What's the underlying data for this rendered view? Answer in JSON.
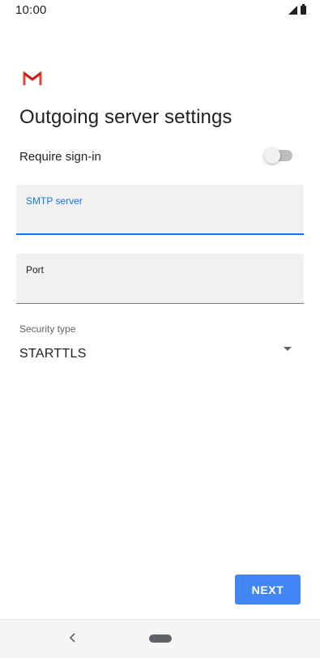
{
  "status_bar": {
    "time": "10:00",
    "icons": [
      "signal-icon",
      "battery-icon"
    ]
  },
  "app": {
    "logo": "gmail-logo-icon",
    "brand_colors": [
      "#ea4335",
      "#c5221f"
    ]
  },
  "page": {
    "title": "Outgoing server settings"
  },
  "require_signin": {
    "label": "Require sign-in",
    "enabled": false
  },
  "smtp_server": {
    "label": "SMTP server",
    "value": "",
    "focused": true
  },
  "port": {
    "label": "Port",
    "value": ""
  },
  "security_type": {
    "label": "Security type",
    "selected": "STARTTLS",
    "icon": "dropdown-arrow-icon"
  },
  "actions": {
    "next_label": "NEXT"
  },
  "nav_bar": {
    "back_icon": "back-chevron-icon",
    "home_icon": "home-pill-icon"
  },
  "colors": {
    "accent": "#1a73e8",
    "button": "#4285f4",
    "field_background": "#f1f1f1"
  }
}
